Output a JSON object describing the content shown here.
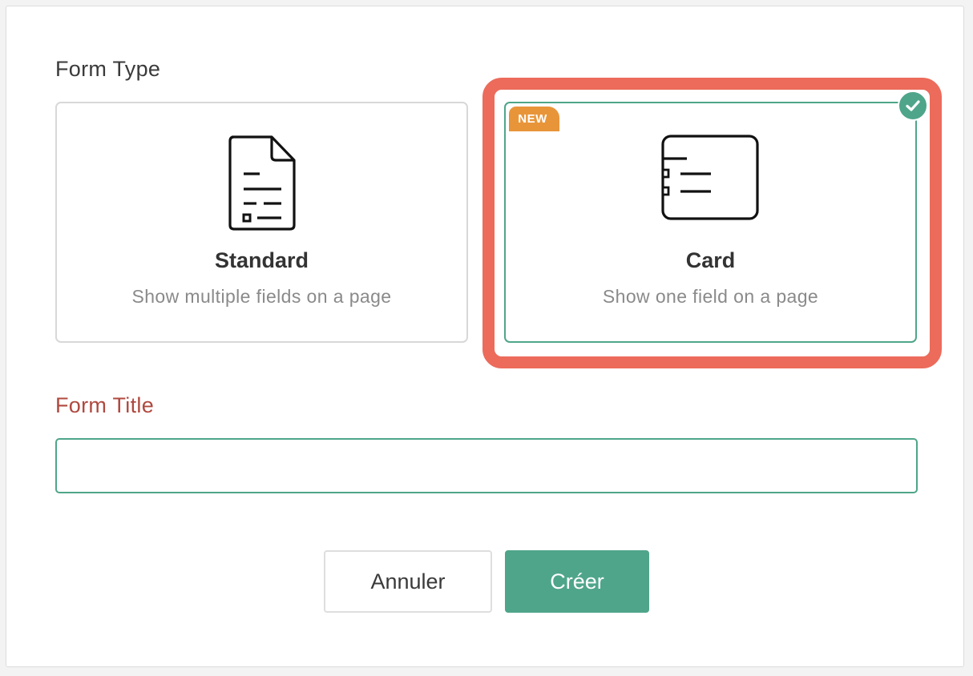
{
  "form_type": {
    "label": "Form Type",
    "options": [
      {
        "title": "Standard",
        "description": "Show multiple fields on a page",
        "icon": "document-icon",
        "selected": false
      },
      {
        "title": "Card",
        "description": "Show one field on a page",
        "icon": "card-layout-icon",
        "badge": "NEW",
        "selected": true
      }
    ]
  },
  "form_title": {
    "label": "Form Title",
    "value": "",
    "placeholder": ""
  },
  "actions": {
    "cancel_label": "Annuler",
    "create_label": "Créer"
  },
  "colors": {
    "accent": "#4fa58a",
    "highlight": "#ec6b5b",
    "badge": "#e8953a",
    "title_label": "#b0493f"
  }
}
